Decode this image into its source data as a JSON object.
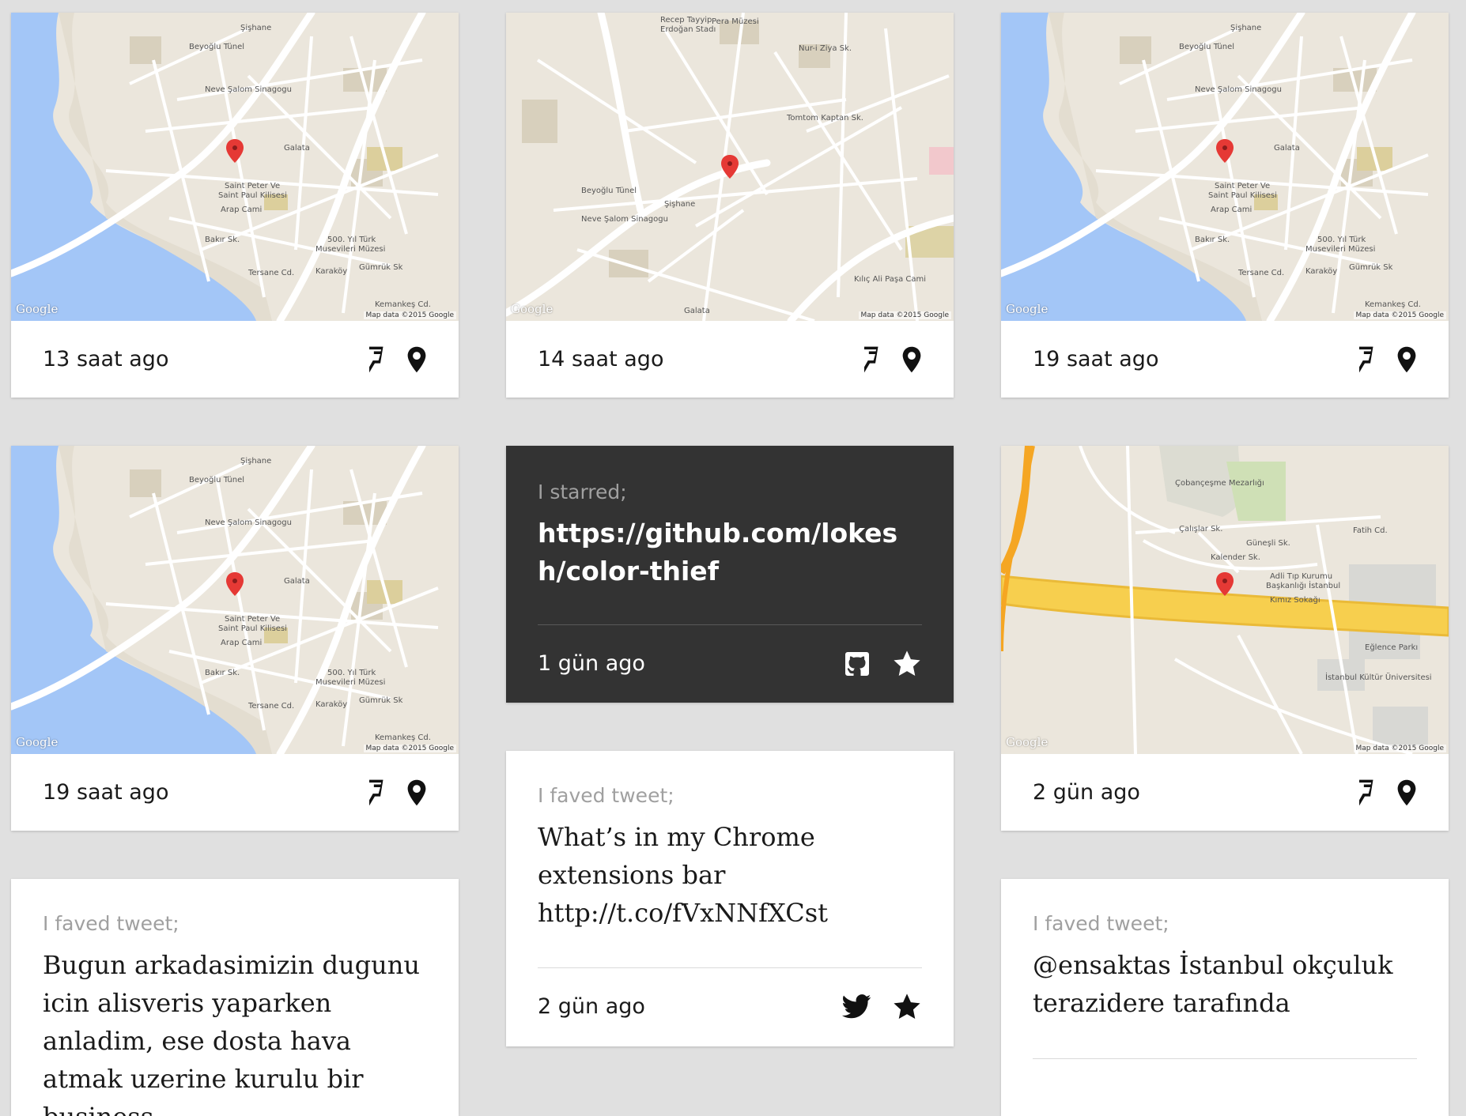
{
  "colors": {
    "background": "#e0e0e0",
    "card": "#ffffff",
    "dark_card": "#333333",
    "water": "#a3c6f7",
    "land": "#ebe6dc",
    "pin": "#e53935"
  },
  "map_brand": "Google",
  "map_attribution": "Map data ©2015 Google",
  "cards": {
    "map1": {
      "time": "13 saat ago",
      "icons": [
        "foursquare-icon",
        "location-pin-icon"
      ]
    },
    "map2": {
      "time": "14 saat ago",
      "icons": [
        "foursquare-icon",
        "location-pin-icon"
      ]
    },
    "map3": {
      "time": "19 saat ago",
      "icons": [
        "foursquare-icon",
        "location-pin-icon"
      ]
    },
    "map4": {
      "time": "19 saat ago",
      "icons": [
        "foursquare-icon",
        "location-pin-icon"
      ]
    },
    "map6": {
      "time": "2 gün ago",
      "icons": [
        "foursquare-icon",
        "location-pin-icon"
      ]
    },
    "starred": {
      "label": "I starred;",
      "title": "https://github.com/lokesh/color-thief",
      "time": "1 gün ago",
      "icons": [
        "github-icon",
        "star-icon"
      ]
    },
    "tweet1": {
      "label": "I faved tweet;",
      "text": "What’s in my Chrome extensions bar http://t.co/fVxNNfXCst",
      "time": "2 gün ago",
      "icons": [
        "twitter-icon",
        "star-icon"
      ]
    },
    "tweet2": {
      "label": "I faved tweet;",
      "text": "Bugun arkadasimizin dugunu icin alisveris yaparken anladim, ese dosta hava atmak uzerine kurulu bir business"
    },
    "tweet3": {
      "label": "I faved tweet;",
      "text": "@ensaktas İstanbul okçuluk terazidere tarafında"
    }
  }
}
